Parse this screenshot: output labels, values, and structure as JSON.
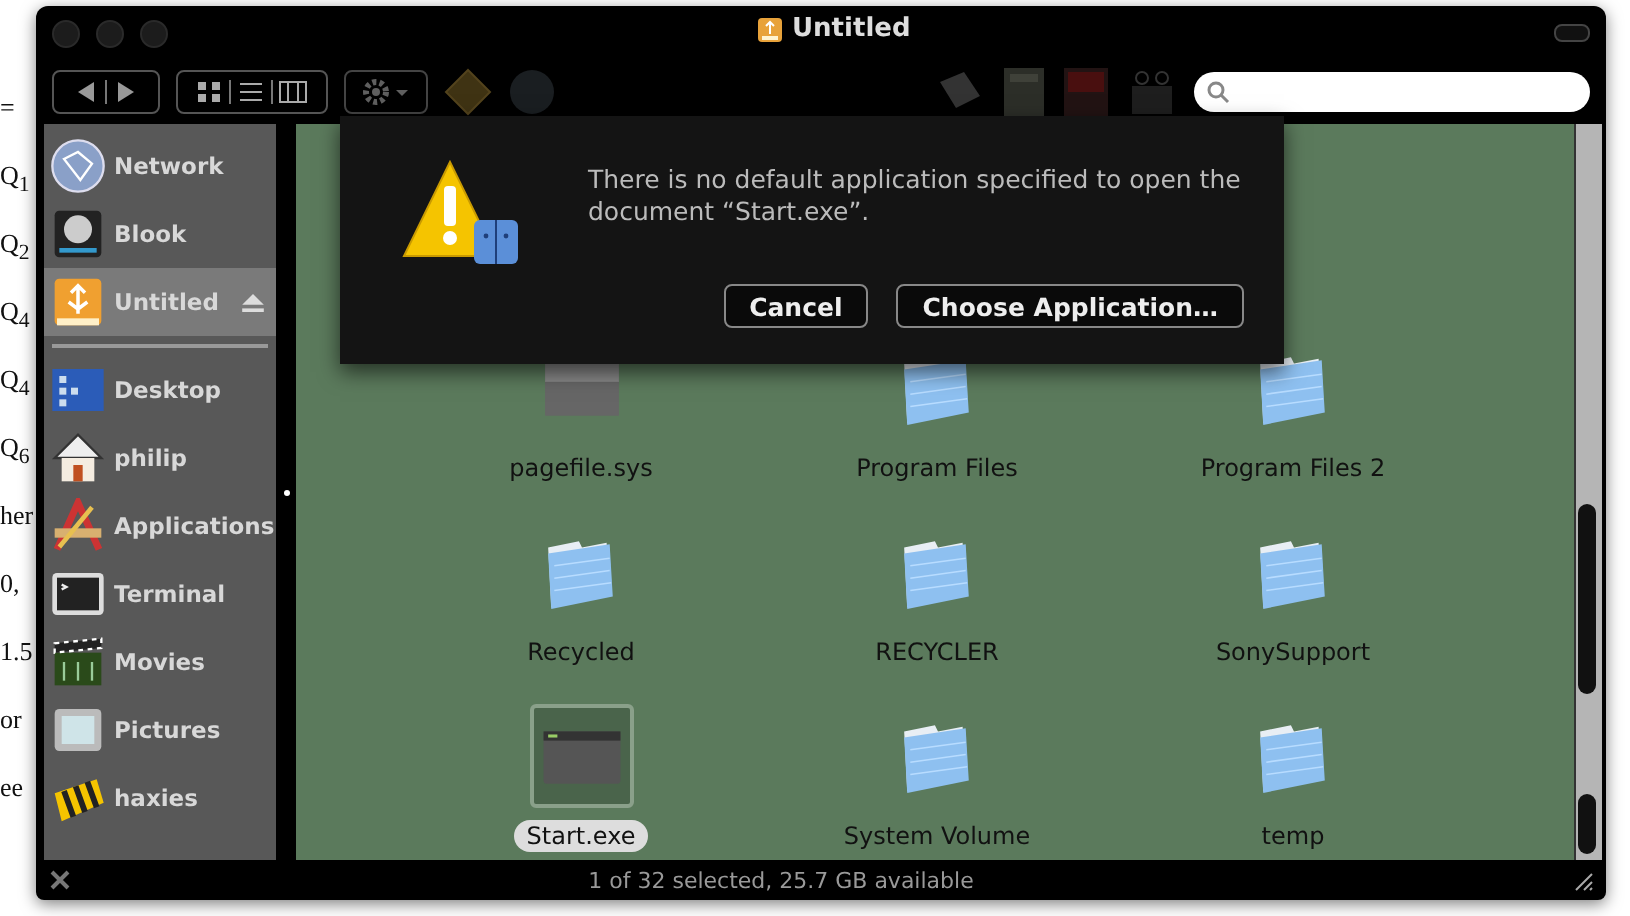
{
  "background_document": {
    "lines": [
      "=",
      "Q$_{1}$",
      "Q$_{2}$",
      "Q$_{4}$",
      "Q$_{4}$",
      "Q$_{6}$",
      "her",
      "0,",
      "1.5",
      "or",
      "ee"
    ]
  },
  "window": {
    "title": "Untitled"
  },
  "sidebar": {
    "devices": [
      {
        "label": "Network",
        "selected": false,
        "ejectable": false
      },
      {
        "label": "Blook",
        "selected": false,
        "ejectable": false
      },
      {
        "label": "Untitled",
        "selected": true,
        "ejectable": true
      }
    ],
    "places": [
      {
        "label": "Desktop",
        "selected": false
      },
      {
        "label": "philip",
        "selected": false
      },
      {
        "label": "Applications",
        "selected": false
      },
      {
        "label": "Terminal",
        "selected": false
      },
      {
        "label": "Movies",
        "selected": false
      },
      {
        "label": "Pictures",
        "selected": false
      },
      {
        "label": "haxies",
        "selected": false
      }
    ]
  },
  "files": [
    {
      "name": "pagefile.sys",
      "kind": "document",
      "selected": false
    },
    {
      "name": "Program Files",
      "kind": "folder",
      "selected": false
    },
    {
      "name": "Program Files 2",
      "kind": "folder",
      "selected": false
    },
    {
      "name": "Recycled",
      "kind": "folder",
      "selected": false
    },
    {
      "name": "RECYCLER",
      "kind": "folder",
      "selected": false
    },
    {
      "name": "SonySupport",
      "kind": "folder",
      "selected": false
    },
    {
      "name": "Start.exe",
      "kind": "app",
      "selected": true
    },
    {
      "name": "System Volume",
      "kind": "folder",
      "selected": false
    },
    {
      "name": "temp",
      "kind": "folder",
      "selected": false
    }
  ],
  "status_bar": "1 of 32 selected, 25.7 GB available",
  "dialog": {
    "message": "There is no default application specified to open the document “Start.exe”.",
    "buttons": [
      "Cancel",
      "Choose Application…"
    ]
  }
}
